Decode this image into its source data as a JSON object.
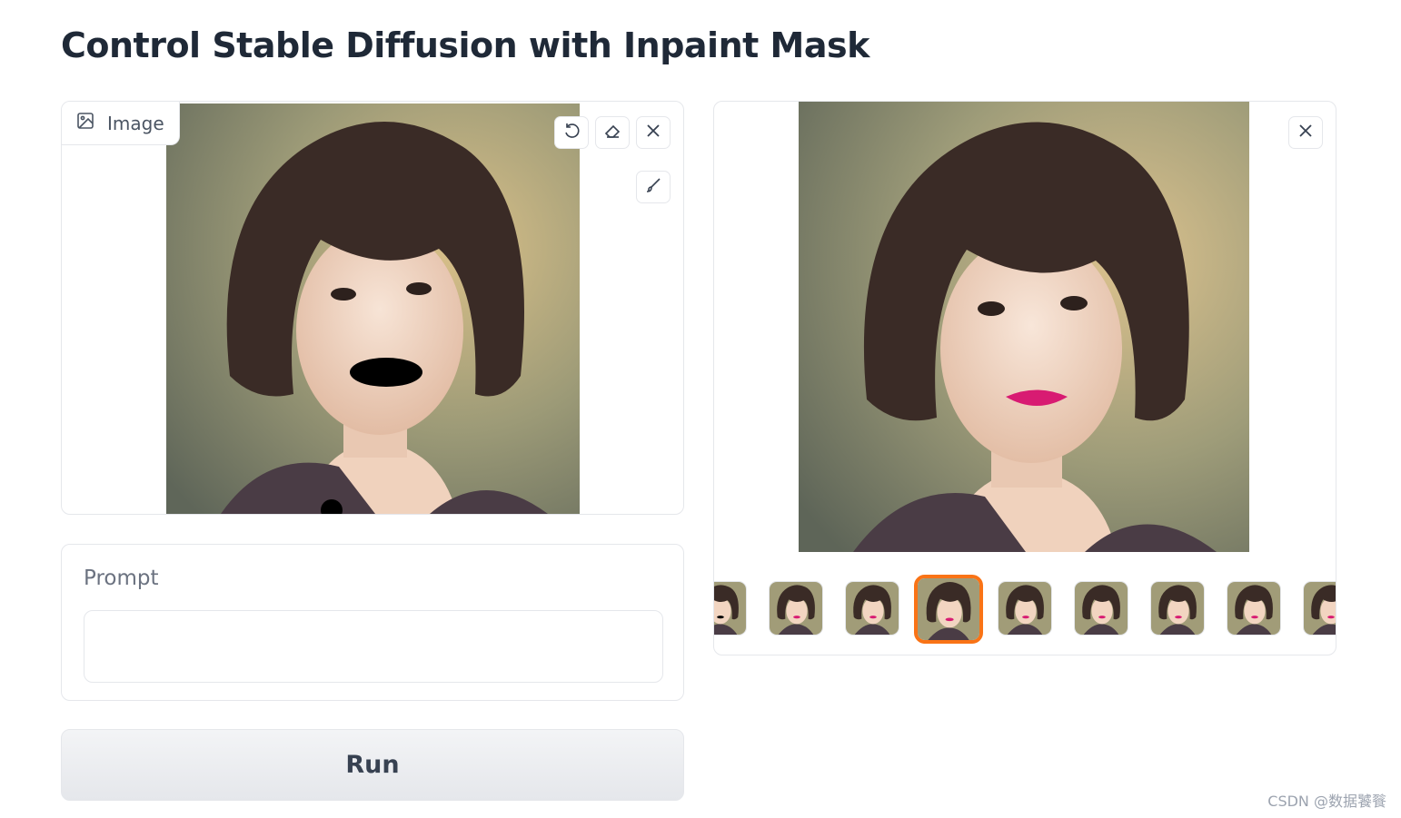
{
  "page": {
    "title": "Control Stable Diffusion with Inpaint Mask"
  },
  "input_image": {
    "label": "Image",
    "label_icon": "image-icon",
    "tools": [
      "undo-icon",
      "eraser-icon",
      "close-icon",
      "brush-icon"
    ]
  },
  "prompt": {
    "label": "Prompt",
    "value": "",
    "placeholder": ""
  },
  "run_button": {
    "label": "Run"
  },
  "gallery": {
    "close_icon": "close-icon",
    "thumbnail_count": 9,
    "selected_index": 3
  },
  "watermark": "CSDN @数据饕餮",
  "colors": {
    "accent_selected": "#f97316",
    "border": "#e5e7eb",
    "title": "#1f2937"
  }
}
